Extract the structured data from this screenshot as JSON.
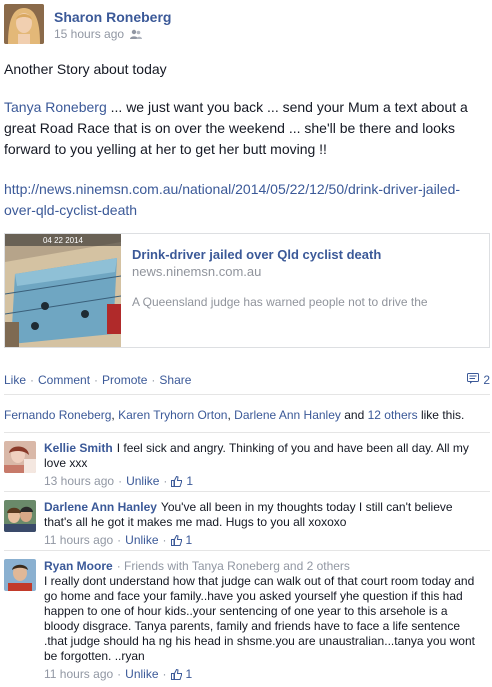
{
  "post": {
    "author": "Sharon Roneberg",
    "timestamp": "15 hours ago",
    "privacy_icon": "friends-icon",
    "title_line": "Another Story about today",
    "mention": "Tanya Roneberg",
    "body_rest": " ... we just want you back ... send your Mum a text about a great Road Race that is on over the weekend ... she'll be there and looks forward to you yelling at her to get her butt moving !!",
    "url": "http://news.ninemsn.com.au/national/2014/05/22/12/50/drink-driver-jailed-over-qld-cyclist-death"
  },
  "link_card": {
    "thumbnail_stamp": "04 22 2014",
    "title": "Drink-driver jailed over Qld cyclist death",
    "domain": "news.ninemsn.com.au",
    "description": "A Queensland judge has warned people not to drive the"
  },
  "actions": {
    "like": "Like",
    "comment": "Comment",
    "promote": "Promote",
    "share": "Share",
    "comment_count": "2"
  },
  "likes": {
    "name1": "Fernando Roneberg",
    "sep1": ", ",
    "name2": "Karen Tryhorn Orton",
    "sep2": ", ",
    "name3": "Darlene Ann Hanley",
    "and": " and ",
    "others": "12 others",
    "suffix": " like this."
  },
  "comments": [
    {
      "name": "Kellie Smith",
      "text": "I feel sick and angry. Thinking of you and have been all day. All my love xxx",
      "time": "13 hours ago",
      "unlike": "Unlike",
      "likes": "1"
    },
    {
      "name": "Darlene Ann Hanley",
      "text": "You've all been in my thoughts today I still can't believe that's all he got it makes me mad. Hugs to you all xoxoxo",
      "time": "11 hours ago",
      "unlike": "Unlike",
      "likes": "1"
    },
    {
      "name": "Ryan Moore",
      "context": "· Friends with Tanya Roneberg and 2 others",
      "text": "I really dont understand how that judge can walk out of that court room today and go home and face your family..have you asked yourself yhe question if this had happen to one of hour kids..your sentencing of one year to this arsehole is a bloody disgrace. Tanya parents, family and friends have to face a life sentence .that judge should ha ng his head in shsme.you are unaustralian...tanya you wont be forgotten. ..ryan",
      "time": "11 hours ago",
      "unlike": "Unlike",
      "likes": "1"
    }
  ],
  "colors": {
    "link": "#3b5998",
    "muted": "#9197a3",
    "border": "#dddfe2"
  }
}
